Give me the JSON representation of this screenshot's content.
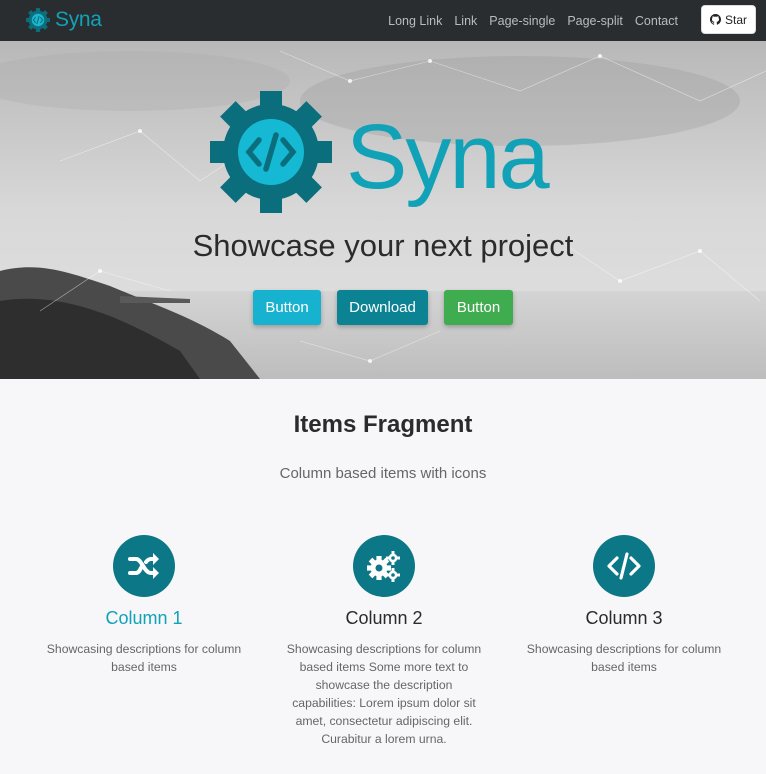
{
  "navbar": {
    "brand": "Syna",
    "links": [
      "Long Link",
      "Link",
      "Page-single",
      "Page-split",
      "Contact"
    ],
    "star_label": "Star"
  },
  "hero": {
    "logo_text": "Syna",
    "title": "Showcase your next project",
    "buttons": [
      "Button",
      "Download",
      "Button"
    ]
  },
  "items": {
    "title": "Items Fragment",
    "subtitle": "Column based items with icons",
    "columns": [
      {
        "icon": "shuffle-icon",
        "title": "Column 1",
        "description": "Showcasing descriptions for column based items"
      },
      {
        "icon": "cogs-icon",
        "title": "Column 2",
        "description": "Showcasing descriptions for column based items Some more text to showcase the description capabilities: Lorem ipsum dolor sit amet, consectetur adipiscing elit. Curabitur a lorem urna."
      },
      {
        "icon": "code-icon",
        "title": "Column 3",
        "description": "Showcasing descriptions for column based items"
      }
    ]
  },
  "colors": {
    "brand_teal": "#11a2b8",
    "dark_teal": "#0c7787",
    "navbar_bg": "#2a2d2f",
    "btn_info": "#17b2cf",
    "btn_primary": "#0b8393",
    "btn_success": "#3fad4f"
  }
}
